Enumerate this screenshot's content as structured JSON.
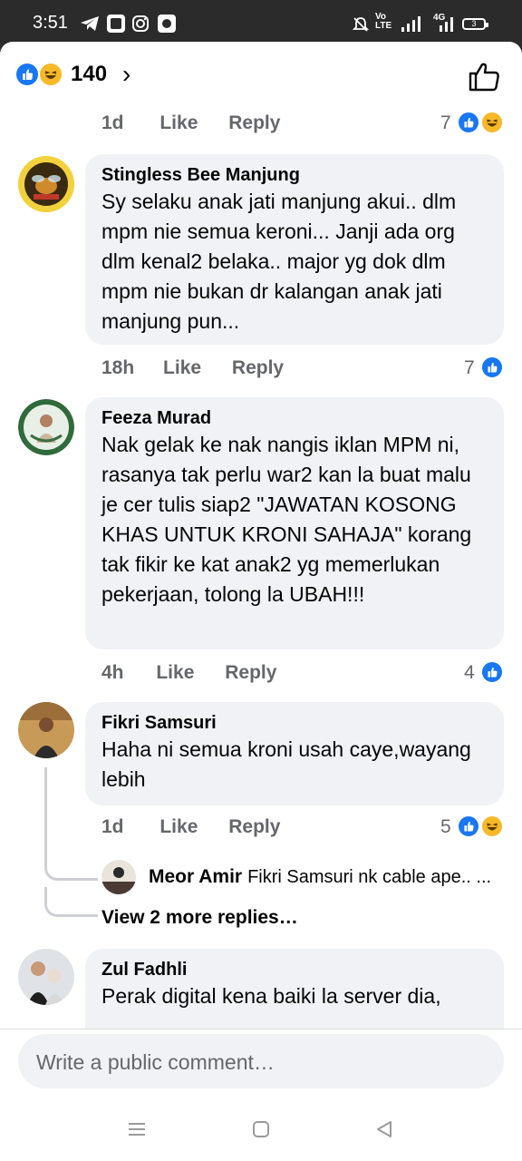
{
  "status_bar": {
    "time": "3:51",
    "network": "4G",
    "battery": "3"
  },
  "header": {
    "reaction_count": "140"
  },
  "comments": [
    {
      "name": "",
      "time": "1d",
      "like_label": "Like",
      "reply_label": "Reply",
      "reaction_count": "7",
      "reactions": [
        "like",
        "haha"
      ]
    },
    {
      "name": "Stingless Bee Manjung",
      "text": "Sy selaku anak jati manjung akui.. dlm mpm nie semua keroni... Janji ada org dlm kenal2 belaka.. major yg dok dlm mpm nie bukan dr kalangan anak jati manjung pun...",
      "time": "18h",
      "like_label": "Like",
      "reply_label": "Reply",
      "reaction_count": "7",
      "reactions": [
        "like"
      ]
    },
    {
      "name": "Feeza Murad",
      "text": "Nak gelak ke nak nangis iklan MPM ni, rasanya tak perlu war2 kan la buat malu je cer tulis siap2 \"JAWATAN KOSONG KHAS UNTUK KRONI SAHAJA\" korang tak fikir ke kat anak2 yg memerlukan pekerjaan, tolong la UBAH!!!",
      "time": "4h",
      "like_label": "Like",
      "reply_label": "Reply",
      "reaction_count": "4",
      "reactions": [
        "like"
      ]
    },
    {
      "name": "Fikri Samsuri",
      "text": "Haha ni semua kroni usah caye,wayang lebih",
      "time": "1d",
      "like_label": "Like",
      "reply_label": "Reply",
      "reaction_count": "5",
      "reactions": [
        "like",
        "haha"
      ],
      "reply_preview": {
        "name": "Meor Amir",
        "text": "Fikri Samsuri nk cable ape.. ..."
      },
      "more_replies": "View 2 more replies…"
    },
    {
      "name": "Zul Fadhli",
      "text": "Perak digital kena baiki la server dia,"
    }
  ],
  "composer": {
    "placeholder": "Write a public comment…"
  },
  "colors": {
    "accent": "#1877f2",
    "haha": "#f7b928",
    "bubble": "#f0f2f5",
    "secondary_text": "#65676b"
  }
}
